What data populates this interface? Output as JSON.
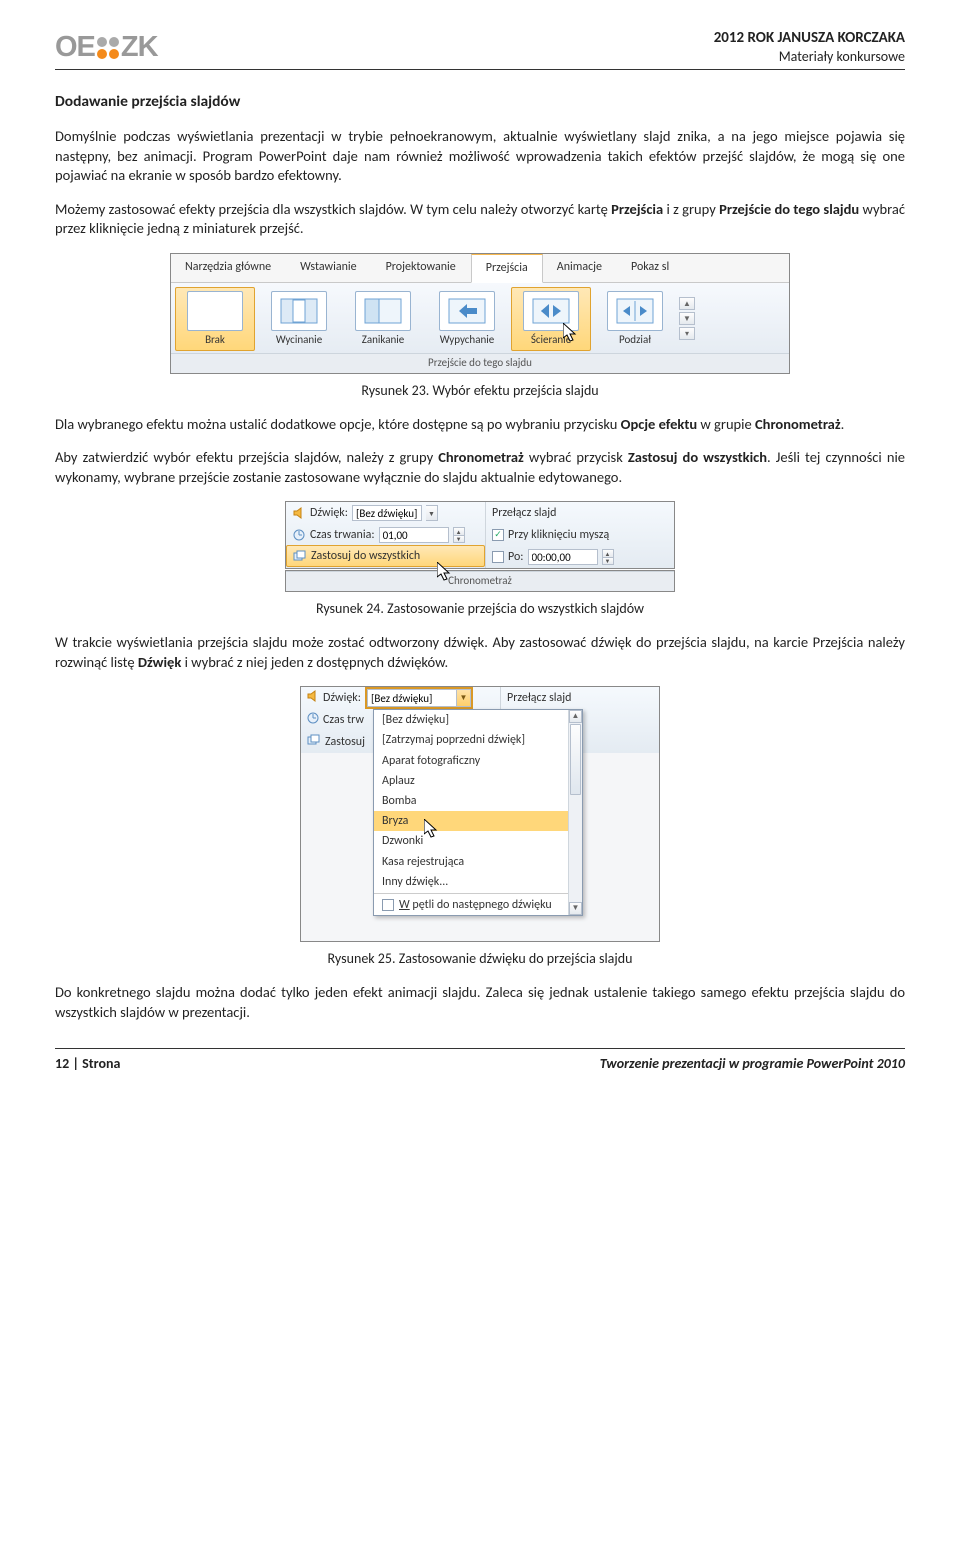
{
  "header": {
    "logo_left": "OE",
    "logo_right": "ZK",
    "line1": "2012 ROK JANUSZA KORCZAKA",
    "line2": "Materiały konkursowe"
  },
  "section_title": "Dodawanie przejścia slajdów",
  "para1": "Domyślnie podczas wyświetlania prezentacji w trybie pełnoekranowym, aktualnie wyświetlany slajd znika, a na jego miejsce pojawia się następny, bez animacji. Program PowerPoint daje nam również możliwość wprowadzenia takich efektów przejść slajdów, że mogą się one pojawiać na ekranie w sposób bardzo efektowny.",
  "para2_a": "Możemy zastosować efekty przejścia dla wszystkich slajdów. W tym celu należy otworzyć kartę ",
  "para2_b": "Przejścia",
  "para2_c": " i z grupy ",
  "para2_d": "Przejście do tego slajdu",
  "para2_e": " wybrać przez kliknięcie jedną z miniaturek przejść.",
  "fig23": {
    "tabs": [
      "Narzędzia główne",
      "Wstawianie",
      "Projektowanie",
      "Przejścia",
      "Animacje",
      "Pokaz sl"
    ],
    "items": [
      {
        "label": "Brak"
      },
      {
        "label": "Wycinanie"
      },
      {
        "label": "Zanikanie"
      },
      {
        "label": "Wypychanie"
      },
      {
        "label": "Ścieranie"
      },
      {
        "label": "Podział"
      }
    ],
    "group": "Przejście do tego slajdu"
  },
  "caption23": "Rysunek 23. Wybór efektu przejścia slajdu",
  "para3_a": "Dla wybranego efektu można ustalić dodatkowe opcje, które dostępne są po wybraniu przycisku ",
  "para3_b": "Opcje efektu",
  "para3_c": " w grupie ",
  "para3_d": "Chronometraż",
  "para3_e": ".",
  "para4_a": "Aby zatwierdzić wybór efektu przejścia slajdów, należy z grupy ",
  "para4_b": "Chronometraż",
  "para4_c": " wybrać przycisk ",
  "para4_d": "Zastosuj do wszystkich",
  "para4_e": ". Jeśli tej czynności nie wykonamy, wybrane przejście zostanie zastosowane wyłącznie do slajdu aktualnie edytowanego.",
  "fig24": {
    "sound_label": "Dźwięk:",
    "sound_value": "[Bez dźwięku]",
    "duration_label": "Czas trwania:",
    "duration_value": "01,00",
    "apply_all": "Zastosuj do wszystkich",
    "advance_label": "Przełącz slajd",
    "on_click": "Przy kliknięciu myszą",
    "after_label": "Po:",
    "after_value": "00:00,00",
    "group": "Chronometraż"
  },
  "caption24": "Rysunek 24. Zastosowanie przejścia do wszystkich slajdów",
  "para5_a": "W trakcie wyświetlania przejścia slajdu może zostać odtworzony dźwięk. Aby zastosować dźwięk do przejścia slajdu, na karcie Przejścia należy rozwinąć listę ",
  "para5_b": "Dźwięk",
  "para5_c": " i wybrać z niej jeden z dostępnych dźwięków.",
  "fig25": {
    "sound_label": "Dźwięk:",
    "sound_value": "[Bez dźwięku]",
    "duration_label_short": "Czas trw",
    "apply_short": "Zastosuj",
    "advance_label": "Przełącz slajd",
    "options": [
      "[Bez dźwięku]",
      "[Zatrzymaj poprzedni dźwięk]",
      "Aparat fotograficzny",
      "Aplauz",
      "Bomba",
      "Bryza",
      "Dzwonki",
      "Kasa rejestrująca",
      "Inny dźwięk..."
    ],
    "loop_label": "W pętli do następnego dźwięku"
  },
  "caption25": "Rysunek 25. Zastosowanie dźwięku do przejścia slajdu",
  "para6": "Do konkretnego slajdu można dodać tylko jeden efekt animacji slajdu. Zaleca się jednak ustalenie takiego samego efektu przejścia slajdu do wszystkich slajdów w prezentacji.",
  "footer": {
    "page_label": "12 | Strona",
    "doc_title": "Tworzenie prezentacji w programie PowerPoint 2010"
  }
}
